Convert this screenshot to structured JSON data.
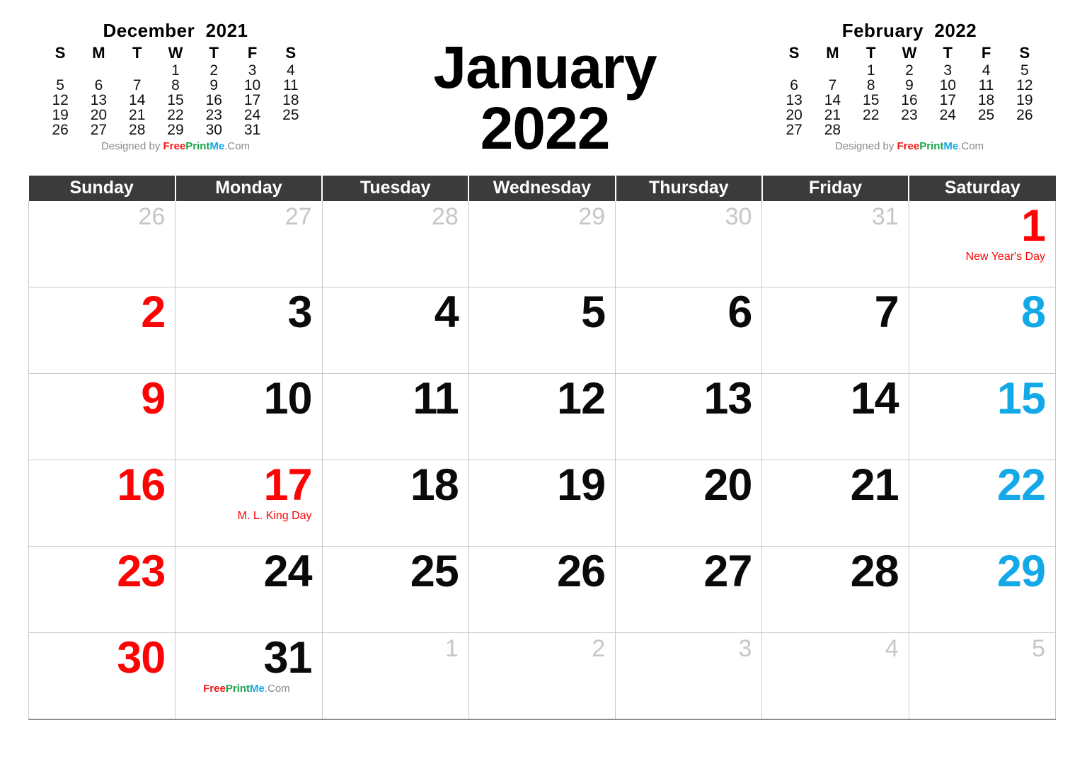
{
  "header": {
    "title_line1": "January",
    "title_line2": "2022"
  },
  "branding": {
    "designed_by": "Designed by ",
    "free": "Free",
    "print": "Print",
    "me": "Me",
    "com": ".Com",
    "colors": {
      "free": "#f01818",
      "print": "#1aa44a",
      "me": "#13a9e8",
      "com": "#8a8a8a"
    }
  },
  "mini_calendars": [
    {
      "position": "left",
      "title": "December  2021",
      "weekday_initials": [
        "S",
        "M",
        "T",
        "W",
        "T",
        "F",
        "S"
      ],
      "weeks": [
        [
          "",
          "",
          "",
          "1",
          "2",
          "3",
          "4"
        ],
        [
          "5",
          "6",
          "7",
          "8",
          "9",
          "10",
          "11"
        ],
        [
          "12",
          "13",
          "14",
          "15",
          "16",
          "17",
          "18"
        ],
        [
          "19",
          "20",
          "21",
          "22",
          "23",
          "24",
          "25"
        ],
        [
          "26",
          "27",
          "28",
          "29",
          "30",
          "31",
          ""
        ]
      ]
    },
    {
      "position": "right",
      "title": "February  2022",
      "weekday_initials": [
        "S",
        "M",
        "T",
        "W",
        "T",
        "F",
        "S"
      ],
      "weeks": [
        [
          "",
          "",
          "1",
          "2",
          "3",
          "4",
          "5"
        ],
        [
          "6",
          "7",
          "8",
          "9",
          "10",
          "11",
          "12"
        ],
        [
          "13",
          "14",
          "15",
          "16",
          "17",
          "18",
          "19"
        ],
        [
          "20",
          "21",
          "22",
          "23",
          "24",
          "25",
          "26"
        ],
        [
          "27",
          "28",
          "",
          "",
          "",
          "",
          ""
        ]
      ]
    }
  ],
  "weekday_headers": [
    "Sunday",
    "Monday",
    "Tuesday",
    "Wednesday",
    "Thursday",
    "Friday",
    "Saturday"
  ],
  "colors": {
    "header_bg": "#3b3b3b",
    "header_text": "#ffffff",
    "sunday": "#fc0404",
    "saturday": "#13a9e8",
    "weekday": "#0a0a0a",
    "adjacent": "#c6c6c6",
    "holiday": "#fc0404",
    "grid_line": "#c9c9c9"
  },
  "weeks": [
    [
      {
        "num": "26",
        "kind": "adj"
      },
      {
        "num": "27",
        "kind": "adj"
      },
      {
        "num": "28",
        "kind": "adj"
      },
      {
        "num": "29",
        "kind": "adj"
      },
      {
        "num": "30",
        "kind": "adj"
      },
      {
        "num": "31",
        "kind": "adj"
      },
      {
        "num": "1",
        "kind": "hol",
        "holiday": "New Year's Day"
      }
    ],
    [
      {
        "num": "2",
        "kind": "sun"
      },
      {
        "num": "3",
        "kind": "wk"
      },
      {
        "num": "4",
        "kind": "wk"
      },
      {
        "num": "5",
        "kind": "wk"
      },
      {
        "num": "6",
        "kind": "wk"
      },
      {
        "num": "7",
        "kind": "wk"
      },
      {
        "num": "8",
        "kind": "sat"
      }
    ],
    [
      {
        "num": "9",
        "kind": "sun"
      },
      {
        "num": "10",
        "kind": "wk"
      },
      {
        "num": "11",
        "kind": "wk"
      },
      {
        "num": "12",
        "kind": "wk"
      },
      {
        "num": "13",
        "kind": "wk"
      },
      {
        "num": "14",
        "kind": "wk"
      },
      {
        "num": "15",
        "kind": "sat"
      }
    ],
    [
      {
        "num": "16",
        "kind": "sun"
      },
      {
        "num": "17",
        "kind": "hol",
        "holiday": "M. L. King Day"
      },
      {
        "num": "18",
        "kind": "wk"
      },
      {
        "num": "19",
        "kind": "wk"
      },
      {
        "num": "20",
        "kind": "wk"
      },
      {
        "num": "21",
        "kind": "wk"
      },
      {
        "num": "22",
        "kind": "sat"
      }
    ],
    [
      {
        "num": "23",
        "kind": "sun"
      },
      {
        "num": "24",
        "kind": "wk"
      },
      {
        "num": "25",
        "kind": "wk"
      },
      {
        "num": "26",
        "kind": "wk"
      },
      {
        "num": "27",
        "kind": "wk"
      },
      {
        "num": "28",
        "kind": "wk"
      },
      {
        "num": "29",
        "kind": "sat"
      }
    ],
    [
      {
        "num": "30",
        "kind": "sun"
      },
      {
        "num": "31",
        "kind": "wk",
        "credit": true
      },
      {
        "num": "1",
        "kind": "adj"
      },
      {
        "num": "2",
        "kind": "adj"
      },
      {
        "num": "3",
        "kind": "adj"
      },
      {
        "num": "4",
        "kind": "adj"
      },
      {
        "num": "5",
        "kind": "adj"
      }
    ]
  ]
}
